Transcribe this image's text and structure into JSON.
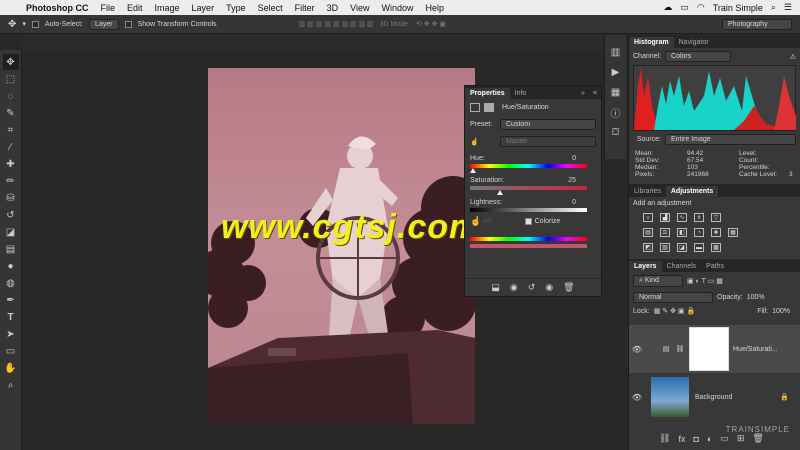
{
  "menubar": {
    "app": "Photoshop CC",
    "items": [
      "File",
      "Edit",
      "Image",
      "Layer",
      "Type",
      "Select",
      "Filter",
      "3D",
      "View",
      "Window",
      "Help"
    ],
    "user": "Train Simple",
    "time": "",
    "workspace": "Photography"
  },
  "options": {
    "auto_select": "Auto-Select:",
    "layer_dd": "Layer",
    "transform": "Show Transform Controls",
    "mode3d": "3D Mode:"
  },
  "properties": {
    "tab1": "Properties",
    "tab2": "Info",
    "title": "Hue/Saturation",
    "preset_label": "Preset:",
    "preset_value": "Custom",
    "channel": "Master",
    "hue_label": "Hue:",
    "hue_value": "0",
    "sat_label": "Saturation:",
    "sat_value": "25",
    "light_label": "Lightness:",
    "light_value": "0",
    "colorize": "Colorize",
    "hue": 0,
    "saturation": 25,
    "lightness": 0
  },
  "histogram": {
    "tab1": "Histogram",
    "tab2": "Navigator",
    "channel_label": "Channel:",
    "channel_value": "Colors",
    "source_label": "Source:",
    "source_value": "Entire Image",
    "stats": [
      [
        "Mean:",
        "94.42",
        "Level:",
        ""
      ],
      [
        "Std Dev:",
        "67.54",
        "Count:",
        ""
      ],
      [
        "Median:",
        "103",
        "Percentile:",
        ""
      ],
      [
        "Pixels:",
        "241968",
        "Cache Level:",
        "3"
      ]
    ]
  },
  "adjustments": {
    "tab1": "Libraries",
    "tab2": "Adjustments",
    "add_label": "Add an adjustment"
  },
  "layers": {
    "tab1": "Layers",
    "tab2": "Channels",
    "tab3": "Paths",
    "kind": "Kind",
    "blend": "Normal",
    "opacity_label": "Opacity:",
    "opacity": "100%",
    "lock_label": "Lock:",
    "fill_label": "Fill:",
    "fill": "100%",
    "items": [
      {
        "name": "Hue/Saturati..."
      },
      {
        "name": "Background"
      }
    ]
  },
  "watermark": "www.cgtsj.com",
  "brand_footer": "TRAINSIMPLE",
  "colors": {
    "accent_yellow": "#f2ef1b",
    "photo_tint": "#b57b84",
    "panel": "#383838"
  }
}
